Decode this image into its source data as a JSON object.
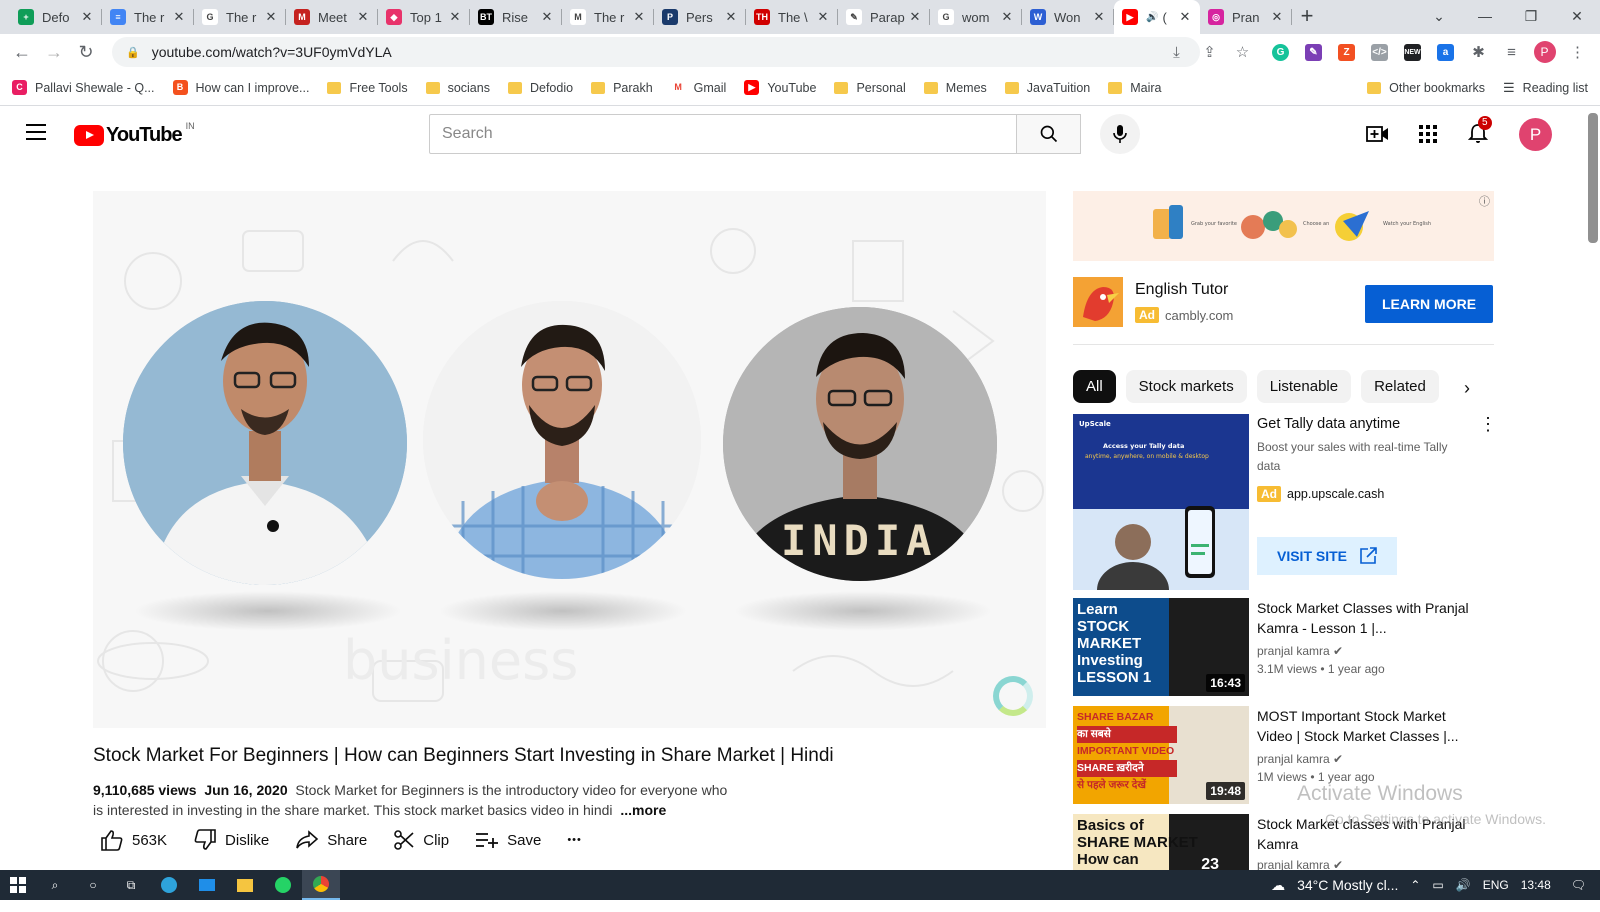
{
  "browser": {
    "tabs": [
      {
        "title": "Defo",
        "favicon_color": "#0f9d58",
        "favicon_text": "+"
      },
      {
        "title": "The r",
        "favicon_color": "#4285f4",
        "favicon_text": "≡"
      },
      {
        "title": "The r",
        "favicon_color": "#ffffff",
        "favicon_text": "G"
      },
      {
        "title": "Meet",
        "favicon_color": "#c5221f",
        "favicon_text": "M"
      },
      {
        "title": "Top 1",
        "favicon_color": "#e8336b",
        "favicon_text": "◆"
      },
      {
        "title": "Rise",
        "favicon_color": "#000000",
        "favicon_text": "BT"
      },
      {
        "title": "The r",
        "favicon_color": "#ffffff",
        "favicon_text": "M"
      },
      {
        "title": "Pers",
        "favicon_color": "#1a3a6b",
        "favicon_text": "P"
      },
      {
        "title": "The \\",
        "favicon_color": "#d00000",
        "favicon_text": "TH"
      },
      {
        "title": "Parap",
        "favicon_color": "#ffffff",
        "favicon_text": "✎"
      },
      {
        "title": "wom",
        "favicon_color": "#ffffff",
        "favicon_text": "G"
      },
      {
        "title": "Won",
        "favicon_color": "#2d5fd3",
        "favicon_text": "W"
      },
      {
        "title": "(",
        "favicon_color": "#ff0000",
        "favicon_text": "▶",
        "active": true
      },
      {
        "title": "Pran",
        "favicon_color": "#d6249f",
        "favicon_text": "◎"
      }
    ],
    "new_tab_label": "+",
    "url": "youtube.com/watch?v=3UF0ymVdYLA",
    "profile_letter": "P",
    "bookmarks": [
      {
        "label": "Pallavi Shewale - Q...",
        "type": "favicon",
        "color": "#e91e63",
        "glyph": "C"
      },
      {
        "label": "How can I improve...",
        "type": "favicon",
        "color": "#f4511e",
        "glyph": "B"
      },
      {
        "label": "Free Tools",
        "type": "folder"
      },
      {
        "label": "socians",
        "type": "folder"
      },
      {
        "label": "Defodio",
        "type": "folder"
      },
      {
        "label": "Parakh",
        "type": "folder"
      },
      {
        "label": "Gmail",
        "type": "favicon",
        "color": "#ffffff",
        "glyph": "M"
      },
      {
        "label": "YouTube",
        "type": "favicon",
        "color": "#ff0000",
        "glyph": "▶"
      },
      {
        "label": "Personal",
        "type": "folder"
      },
      {
        "label": "Memes",
        "type": "folder"
      },
      {
        "label": "JavaTuition",
        "type": "folder"
      },
      {
        "label": "Maira",
        "type": "folder"
      }
    ],
    "other_bookmarks": "Other bookmarks",
    "reading_list": "Reading list"
  },
  "youtube": {
    "logo_text": "YouTube",
    "country_code": "IN",
    "search_placeholder": "Search",
    "notification_count": "5",
    "avatar_letter": "P"
  },
  "video": {
    "title": "Stock Market For Beginners | How can Beginners Start Investing in Share Market | Hindi",
    "views": "9,110,685 views",
    "date": "Jun 16, 2020",
    "description": "Stock Market for Beginners is the introductory video for everyone who is interested in investing in the share market. This stock market basics video in hindi",
    "more_label": "...more",
    "overlay_word": "INDIA",
    "actions": {
      "like_count": "563K",
      "dislike": "Dislike",
      "share": "Share",
      "clip": "Clip",
      "save": "Save",
      "more": "•••"
    }
  },
  "sidebar": {
    "ad": {
      "title": "English Tutor",
      "ad_label": "Ad",
      "domain": "cambly.com",
      "cta": "LEARN MORE"
    },
    "chips": [
      "All",
      "Stock markets",
      "Listenable",
      "Related"
    ],
    "promoted": {
      "title": "Get Tally data anytime",
      "description": "Boost your sales with real-time Tally data",
      "ad_label": "Ad",
      "domain": "app.upscale.cash",
      "cta": "VISIT SITE",
      "thumb_brand": "UpScale",
      "thumb_headline": "Access your Tally data anytime, anywhere, on mobile & desktop"
    },
    "recommendations": [
      {
        "title": "Stock Market Classes with Pranjal Kamra - Lesson 1 |...",
        "channel": "pranjal kamra",
        "views": "3.1M views",
        "age": "1 year ago",
        "duration": "16:43",
        "thumb_text": [
          "Learn",
          "STOCK",
          "MARKET",
          "Investing",
          "LESSON 1"
        ]
      },
      {
        "title": "MOST Important Stock Market Video | Stock Market Classes |...",
        "channel": "pranjal kamra",
        "views": "1M views",
        "age": "1 year ago",
        "duration": "19:48",
        "thumb_text": [
          "SHARE BAZAR",
          "का सबसे",
          "IMPORTANT VIDEO",
          "SHARE ख़रीदने",
          "से पहले जरूर देखें"
        ]
      },
      {
        "title": "Stock Market classes with Pranjal Kamra",
        "channel": "pranjal kamra",
        "views": "",
        "age": "",
        "duration": "23",
        "thumb_text": [
          "Basics of",
          "SHARE MARKET",
          "How can"
        ]
      }
    ]
  },
  "watermark": {
    "line1": "Activate Windows",
    "line2": "Go to Settings to activate Windows."
  },
  "taskbar": {
    "weather": "34°C  Mostly cl...",
    "language": "ENG",
    "time": "13:48"
  }
}
